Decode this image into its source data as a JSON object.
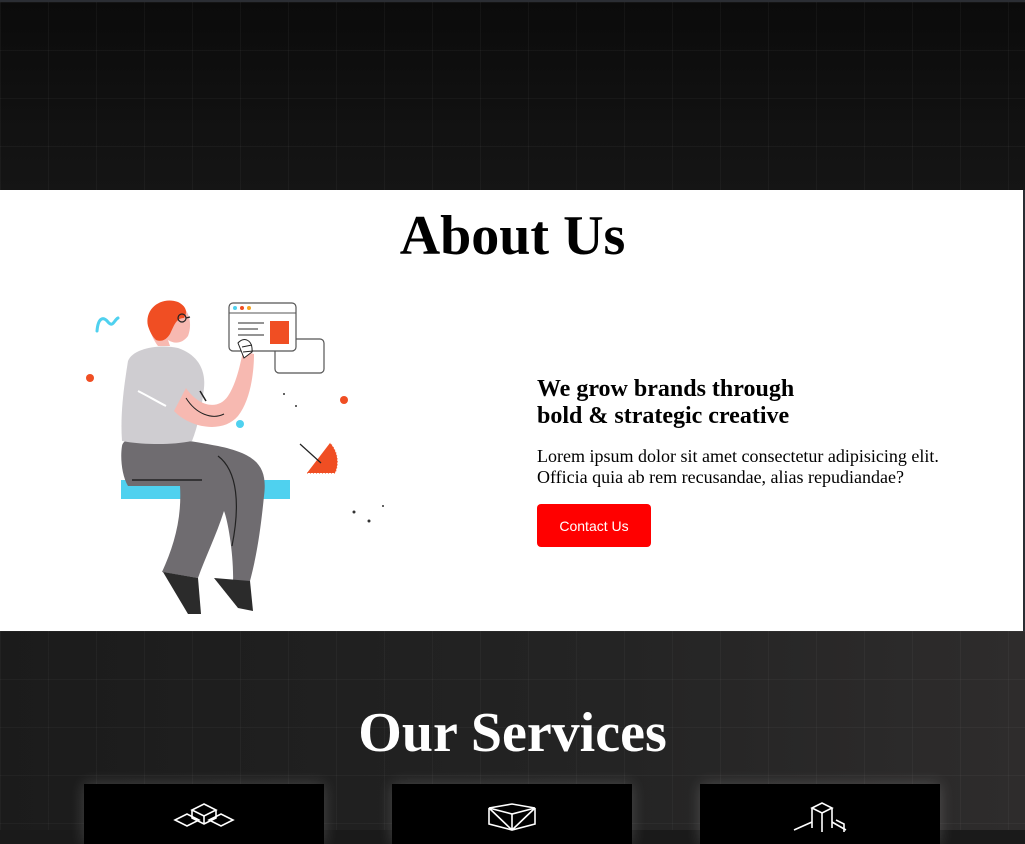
{
  "about": {
    "title": "About Us",
    "subtitle": "We grow brands through\nbold & strategic creative",
    "text": "Lorem ipsum dolor sit amet consectetur adipisicing elit. Officia quia ab rem recusandae, alias repudiandae?",
    "cta_label": "Contact Us",
    "illustration": "person-sitting-with-browser-window-illustration"
  },
  "services": {
    "title": "Our Services",
    "cards": [
      {
        "icon": "stacked-blocks-icon"
      },
      {
        "icon": "open-box-icon"
      },
      {
        "icon": "cube-structure-icon"
      }
    ]
  },
  "colors": {
    "accent": "#ff0000",
    "illustration_orange": "#f04e23",
    "illustration_cyan": "#4fd1ef",
    "dark_bg": "#111111"
  }
}
